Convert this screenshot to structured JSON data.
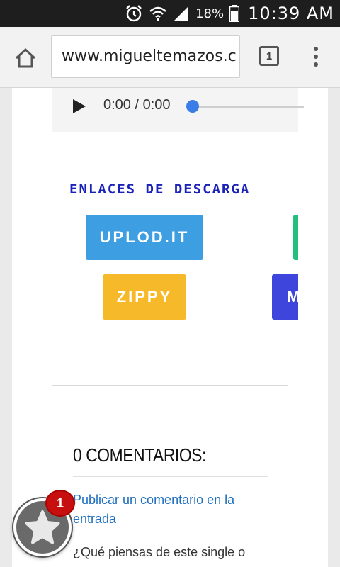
{
  "status_bar": {
    "battery_percent": "18%",
    "time": "10:39 AM",
    "icons": [
      "alarm-icon",
      "wifi-icon",
      "signal-icon",
      "battery-icon"
    ]
  },
  "browser": {
    "url": "www.migueltemazos.c",
    "tab_count": "1",
    "icons": [
      "home-icon",
      "tabs-icon",
      "overflow-menu-icon"
    ]
  },
  "audio": {
    "time_display": "0:00 / 0:00",
    "progress": 0
  },
  "downloads": {
    "title": "ENLACES DE DESCARGA",
    "buttons": [
      {
        "label": "UPLOD.IT",
        "color": "#3d9ee2"
      },
      {
        "label": "",
        "color": "#22c07c"
      },
      {
        "label": "ZIPPY",
        "color": "#f6b92a"
      },
      {
        "label": "M",
        "color": "#3e45dd"
      }
    ]
  },
  "comments": {
    "heading": "0 COMENTARIOS:",
    "post_link": "Publicar un comentario en la entrada",
    "question": "¿Qué piensas de este single o"
  },
  "fab": {
    "badge_count": "1",
    "icon": "star-icon"
  }
}
